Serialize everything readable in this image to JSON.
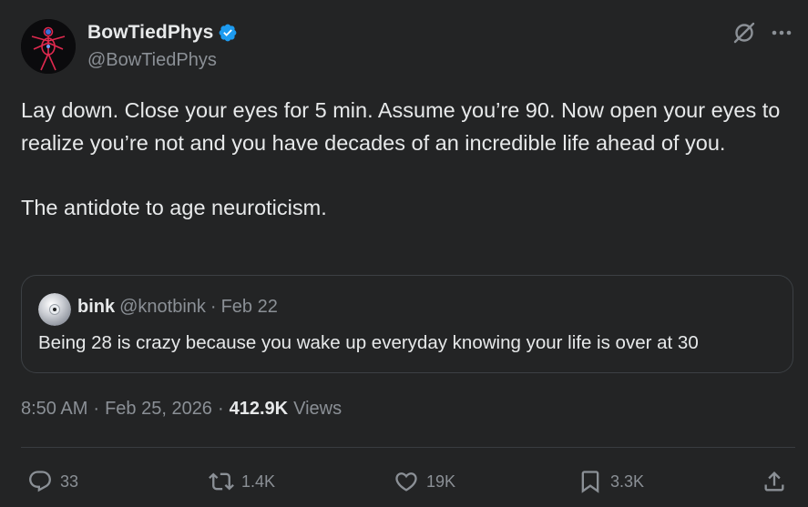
{
  "author": {
    "display_name": "BowTiedPhys",
    "handle": "@BowTiedPhys"
  },
  "tweet": {
    "paragraphs": [
      "Lay down. Close your eyes for 5 min. Assume you’re 90. Now open your eyes to realize you’re not and you have decades of an incredible life ahead of you.",
      "The antidote to age neuroticism."
    ]
  },
  "quote": {
    "name": "bink",
    "handle": "@knotbink",
    "separator": "·",
    "date": "Feb 22",
    "text": "Being 28 is crazy because you wake up everyday knowing your life is over at 30"
  },
  "meta": {
    "time": "8:50 AM",
    "dot1": "·",
    "date": "Feb 25, 2026",
    "dot2": "·",
    "views_count": "412.9K",
    "views_label": "Views"
  },
  "actions": {
    "replies": "33",
    "reposts": "1.4K",
    "likes": "19K",
    "bookmarks": "3.3K"
  },
  "colors": {
    "background": "#232425",
    "text": "#e7e9ea",
    "muted": "#8b9096",
    "verified": "#1d9bf0"
  },
  "icons": [
    "verified-badge-icon",
    "grok-icon",
    "more-icon",
    "reply-icon",
    "repost-icon",
    "like-icon",
    "bookmark-icon",
    "share-icon"
  ]
}
